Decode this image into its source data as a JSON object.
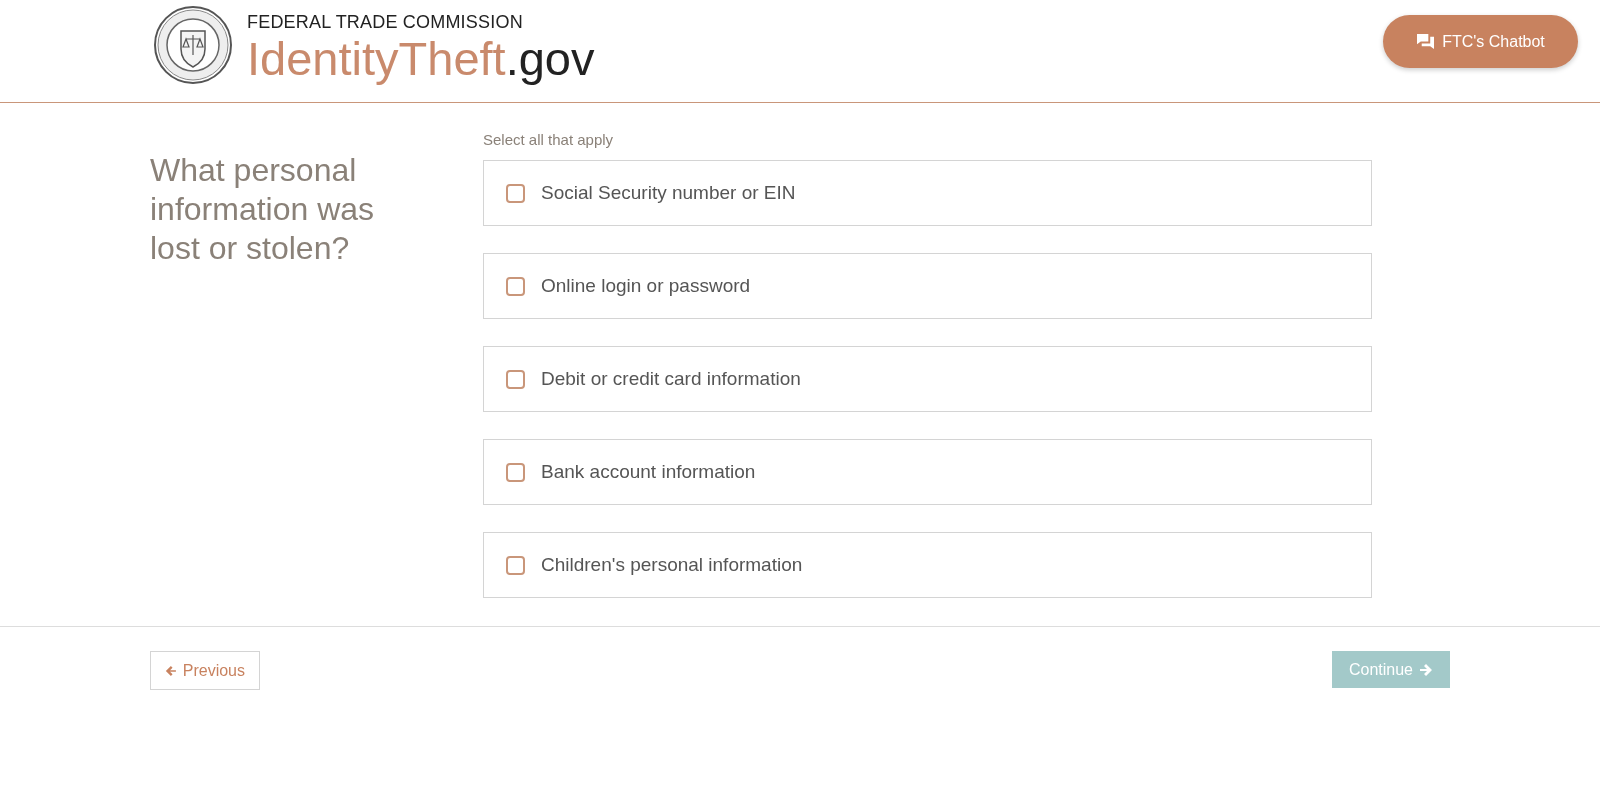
{
  "header": {
    "agency": "FEDERAL TRADE COMMISSION",
    "site_name": "IdentityTheft",
    "site_suffix": ".gov",
    "chatbot_button": "FTC's Chatbot"
  },
  "question": "What personal information was lost or stolen?",
  "hint": "Select all that apply",
  "options": [
    {
      "label": "Social Security number or EIN",
      "checked": false
    },
    {
      "label": "Online login or password",
      "checked": false
    },
    {
      "label": "Debit or credit card information",
      "checked": false
    },
    {
      "label": "Bank account information",
      "checked": false
    },
    {
      "label": "Children's personal information",
      "checked": false
    }
  ],
  "footer": {
    "previous": {
      "label": "Previous",
      "disabled": false
    },
    "continue": {
      "label": "Continue",
      "disabled": true
    }
  }
}
